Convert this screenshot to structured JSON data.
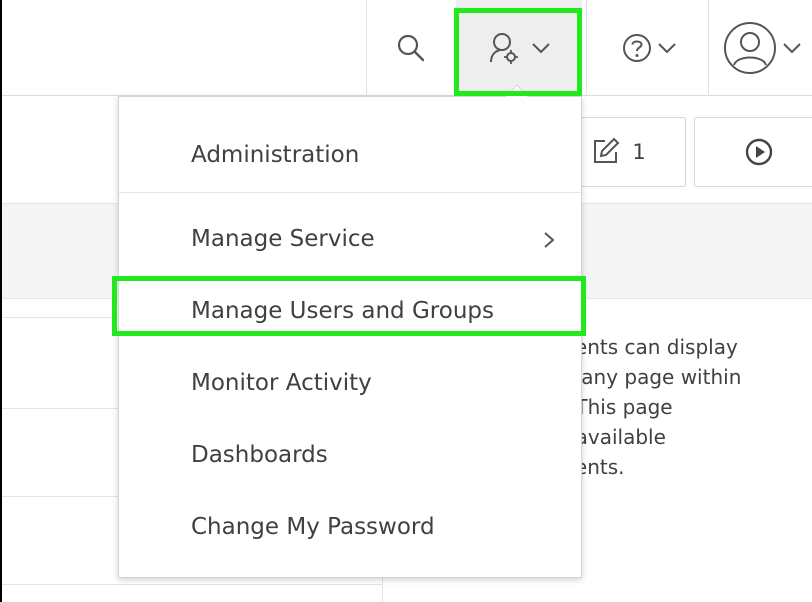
{
  "header": {
    "icons": {
      "search": "search-icon",
      "admin": "administration-icon",
      "help": "help-icon",
      "user": "user-avatar-icon",
      "dropdown": "chevron-down-icon"
    }
  },
  "toolbar": {
    "edit_count": "1",
    "icons": {
      "edit": "edit-icon",
      "run": "play-icon"
    }
  },
  "menu": {
    "items": [
      {
        "label": "Administration"
      },
      {
        "label": "Manage Service",
        "has_submenu": true
      },
      {
        "label": "Manage Users and Groups",
        "highlighted": true
      },
      {
        "label": "Monitor Activity"
      },
      {
        "label": "Dashboards"
      },
      {
        "label": "Change My Password"
      }
    ]
  },
  "background_text": {
    "lines": [
      "onents can display",
      "on any page within",
      "n. This page",
      "of available",
      "onents."
    ]
  },
  "colors": {
    "highlight": "#22e81e",
    "text": "#404040",
    "active_header_button": "#eeeeee"
  }
}
